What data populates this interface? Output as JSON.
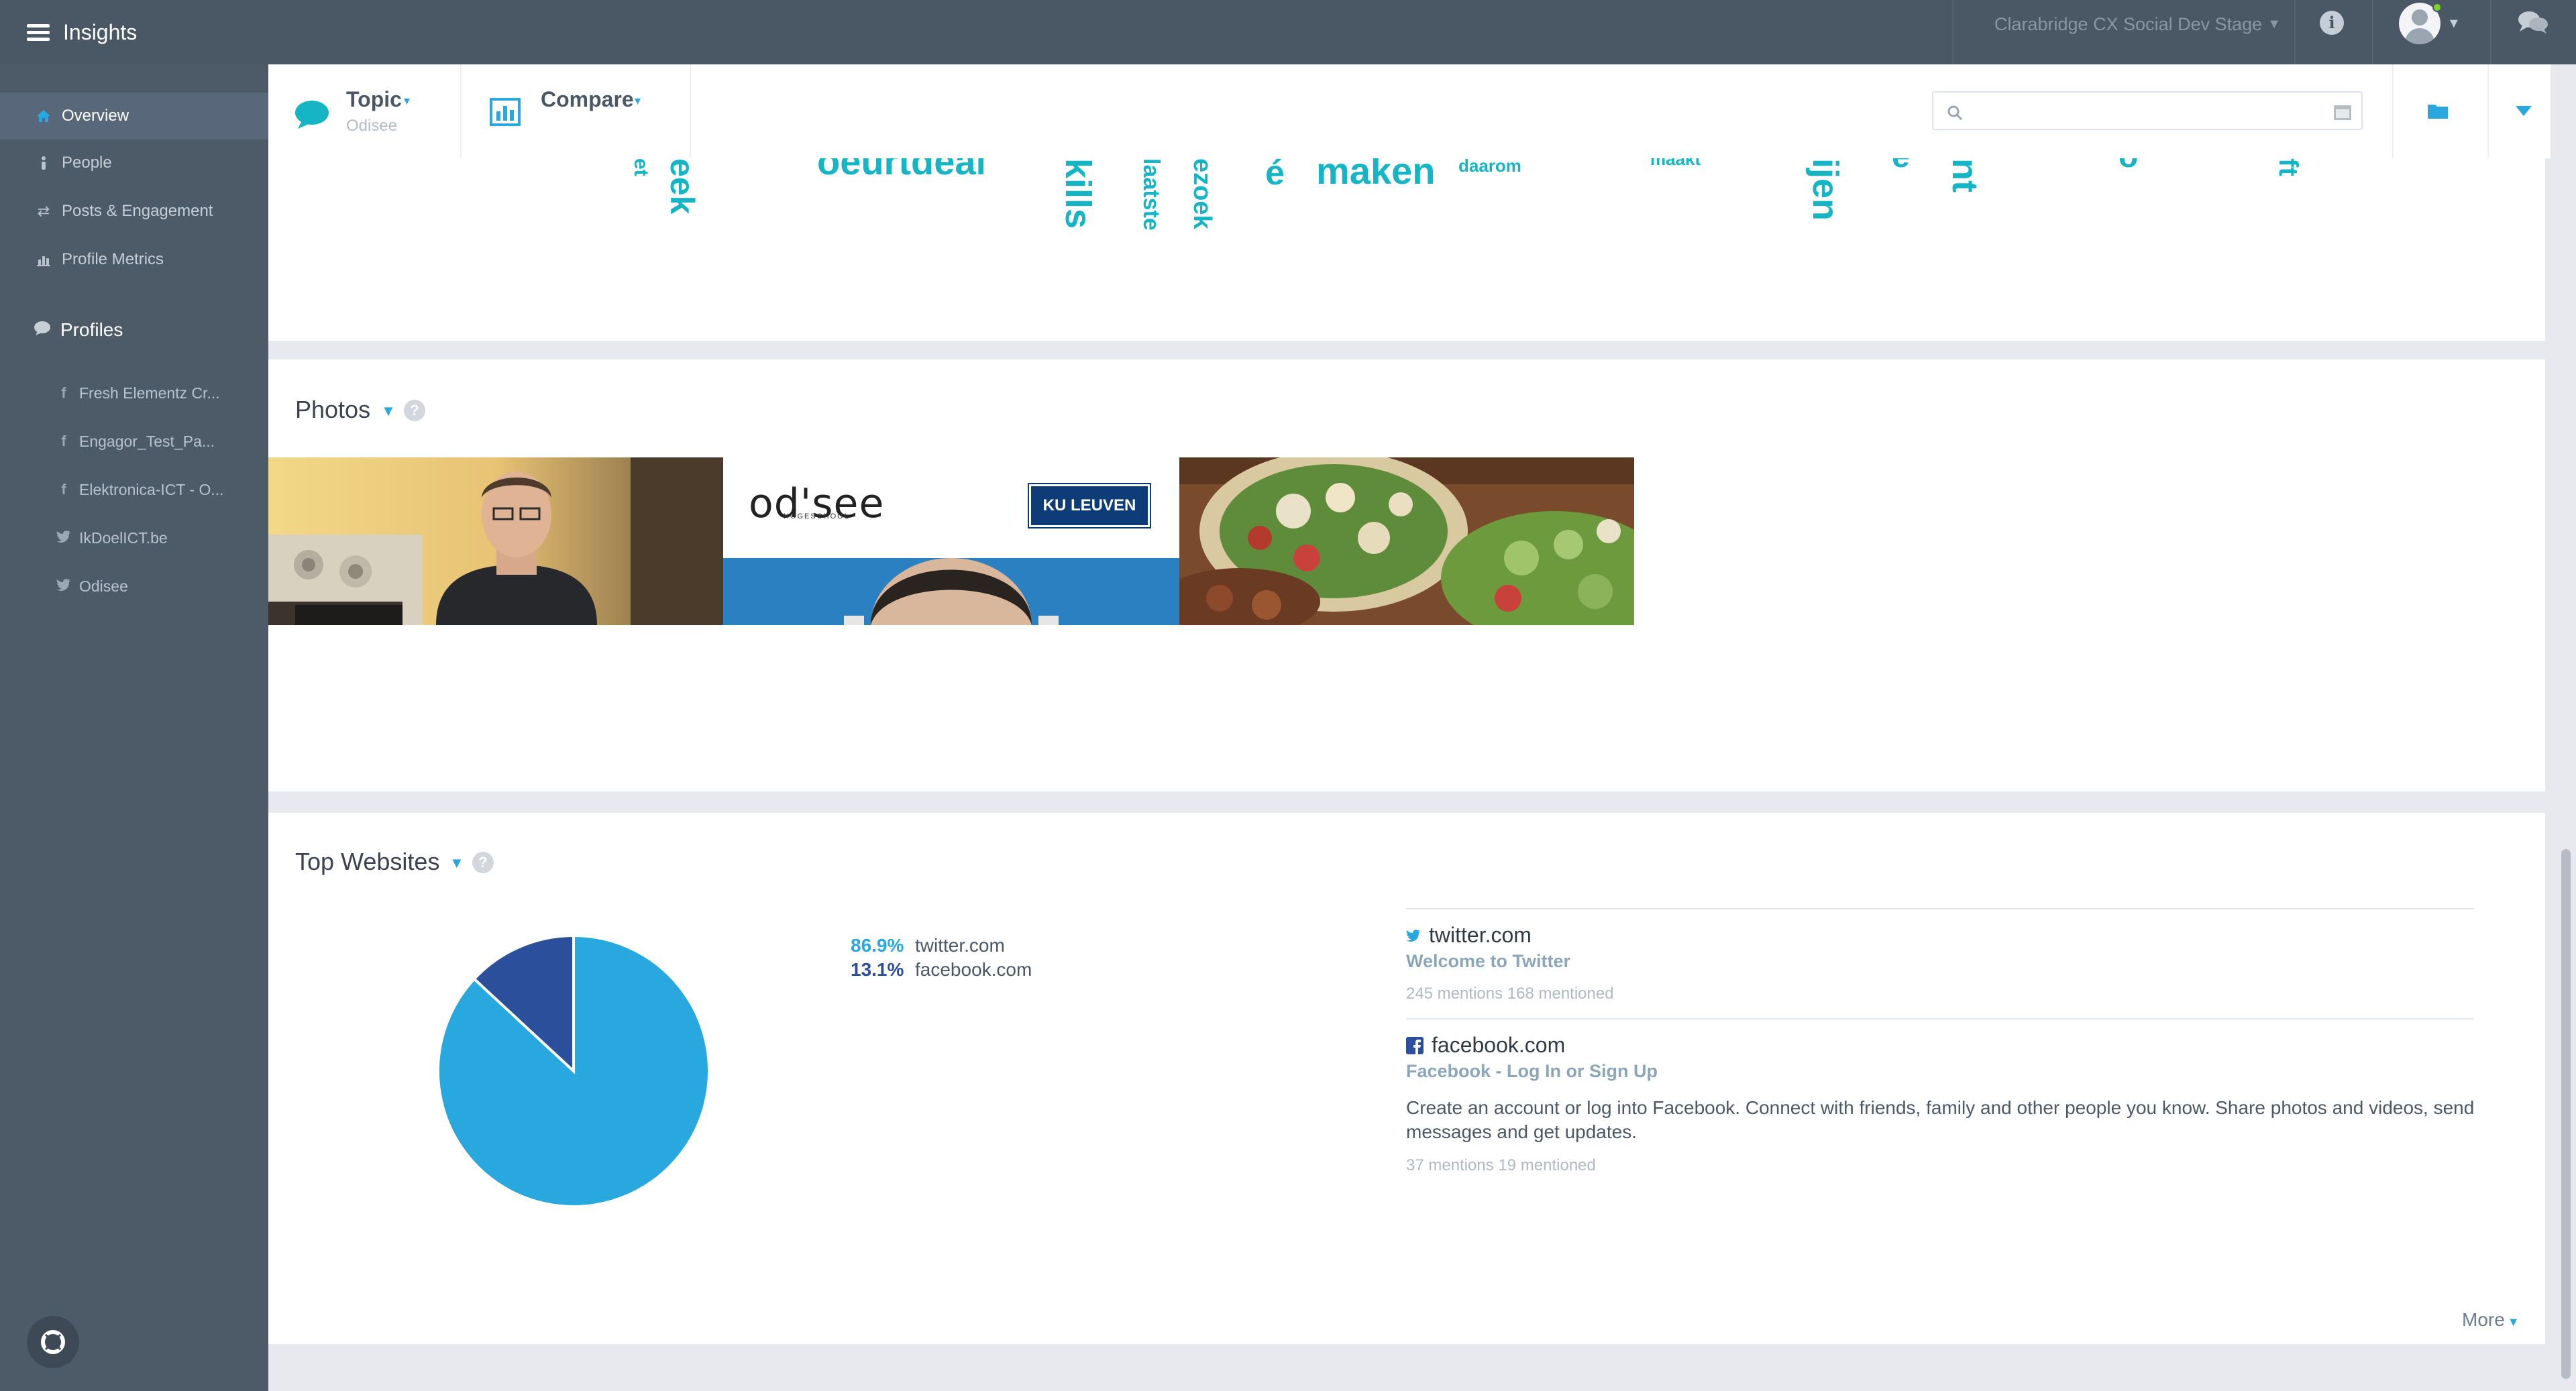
{
  "app": {
    "title": "Insights"
  },
  "topbar": {
    "workspace": "Clarabridge CX Social Dev Stage",
    "info_icon": "info-icon",
    "chat_icon": "chat-bubbles-icon",
    "status_color": "#7ed321"
  },
  "sidebar": {
    "nav": [
      {
        "label": "Overview",
        "icon": "home-icon",
        "active": true
      },
      {
        "label": "People",
        "icon": "person-icon"
      },
      {
        "label": "Posts & Engagement",
        "icon": "retweet-icon"
      },
      {
        "label": "Profile Metrics",
        "icon": "bar-chart-icon"
      }
    ],
    "profiles_header": "Profiles",
    "profiles": [
      {
        "label": "Fresh Elementz Cr...",
        "network": "facebook"
      },
      {
        "label": "Engagor_Test_Pa...",
        "network": "facebook"
      },
      {
        "label": "Elektronica-ICT - O...",
        "network": "facebook"
      },
      {
        "label": "IkDoelICT.be",
        "network": "twitter"
      },
      {
        "label": "Odisee",
        "network": "twitter"
      }
    ]
  },
  "toolbar": {
    "topic_label": "Topic",
    "topic_value": "Odisee",
    "compare_label": "Compare",
    "search_placeholder": "",
    "calendar_icon": "calendar-icon",
    "folder_icon": "folder-icon",
    "dropdown_icon": "chevron-down-icon"
  },
  "word_cloud": {
    "words": [
      "et",
      "eek",
      "oeurtdeal",
      "kills",
      "laatste",
      "ezoek",
      "é",
      "maken",
      "daarom",
      "maakt",
      "ijen",
      "e",
      "nt",
      "ó",
      "ft"
    ],
    "color": "#15b5c5"
  },
  "photos": {
    "title": "Photos",
    "items": [
      {
        "alt": "man-in-office-photo"
      },
      {
        "alt": "odisee-ku-leuven-banner",
        "brand_text": "od'see",
        "brand_sub": "HOGESCHOOL",
        "badge_text": "KU LEUVEN"
      },
      {
        "alt": "food-platter-photo"
      }
    ]
  },
  "top_websites": {
    "title": "Top Websites",
    "legend": [
      {
        "pct": "86.9%",
        "name": "twitter.com",
        "color": "#29a8e0"
      },
      {
        "pct": "13.1%",
        "name": "facebook.com",
        "color": "#2b4f9b"
      }
    ],
    "sites": [
      {
        "name": "twitter.com",
        "title": "Welcome to Twitter",
        "meta": "245 mentions 168 mentioned",
        "icon": "twitter-icon"
      },
      {
        "name": "facebook.com",
        "title": "Facebook - Log In or Sign Up",
        "description": "Create an account or log into Facebook. Connect with friends, family and other people you know. Share photos and videos, send messages and get updates.",
        "meta": "37 mentions 19 mentioned",
        "icon": "facebook-icon"
      }
    ],
    "more_label": "More"
  },
  "chart_data": {
    "type": "pie",
    "categories": [
      "twitter.com",
      "facebook.com"
    ],
    "values": [
      86.9,
      13.1
    ],
    "colors": [
      "#29a8e0",
      "#2b4f9b"
    ]
  }
}
